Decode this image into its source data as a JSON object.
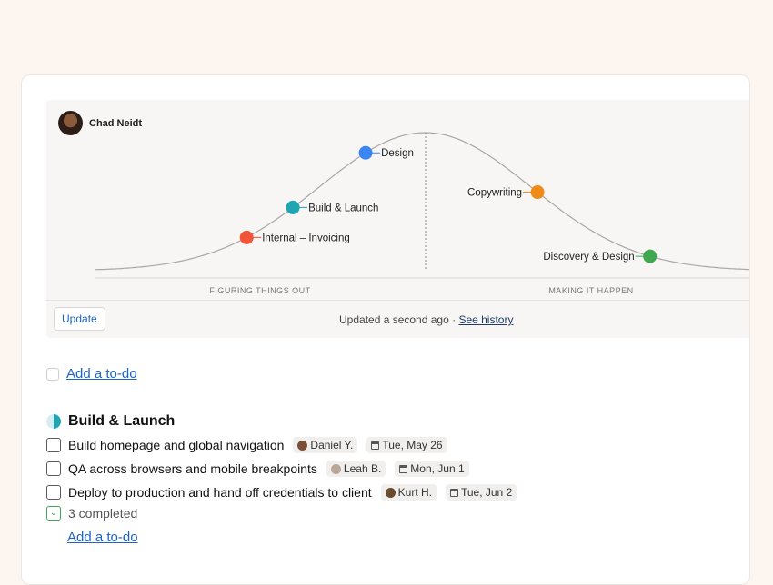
{
  "hill_chart": {
    "author": "Chad Neidt",
    "left_label": "FIGURING THINGS OUT",
    "right_label": "MAKING IT HAPPEN",
    "points": [
      {
        "label": "Internal – Invoicing",
        "progress": 0.23,
        "color": "#f0553a",
        "label_side": "right"
      },
      {
        "label": "Build & Launch",
        "progress": 0.3,
        "color": "#1ea7b3",
        "label_side": "right"
      },
      {
        "label": "Design",
        "progress": 0.41,
        "color": "#3b86f2",
        "label_side": "right"
      },
      {
        "label": "Copywriting",
        "progress": 0.67,
        "color": "#f28a1a",
        "label_side": "left"
      },
      {
        "label": "Discovery & Design",
        "progress": 0.84,
        "color": "#3fa84f",
        "label_side": "left"
      }
    ],
    "update_button": "Update",
    "updated_text": "Updated a second ago · ",
    "history_link": "See history"
  },
  "add_todo_top": "Add a to-do",
  "group": {
    "title": "Build & Launch",
    "icon": "half-circle-progress-icon",
    "todos": [
      {
        "title": "Build homepage and global navigation",
        "assignee": "Daniel Y.",
        "avatar_color": "#7a4e37",
        "due": "Tue, May 26"
      },
      {
        "title": "QA across browsers and mobile breakpoints",
        "assignee": "Leah B.",
        "avatar_color": "#b9a79a",
        "due": "Mon, Jun 1"
      },
      {
        "title": "Deploy to production and hand off credentials to client",
        "assignee": "Kurt H.",
        "avatar_color": "#6b4a2e",
        "due": "Tue, Jun 2"
      }
    ],
    "completed_text": "3 completed",
    "add_todo": "Add a to-do"
  }
}
